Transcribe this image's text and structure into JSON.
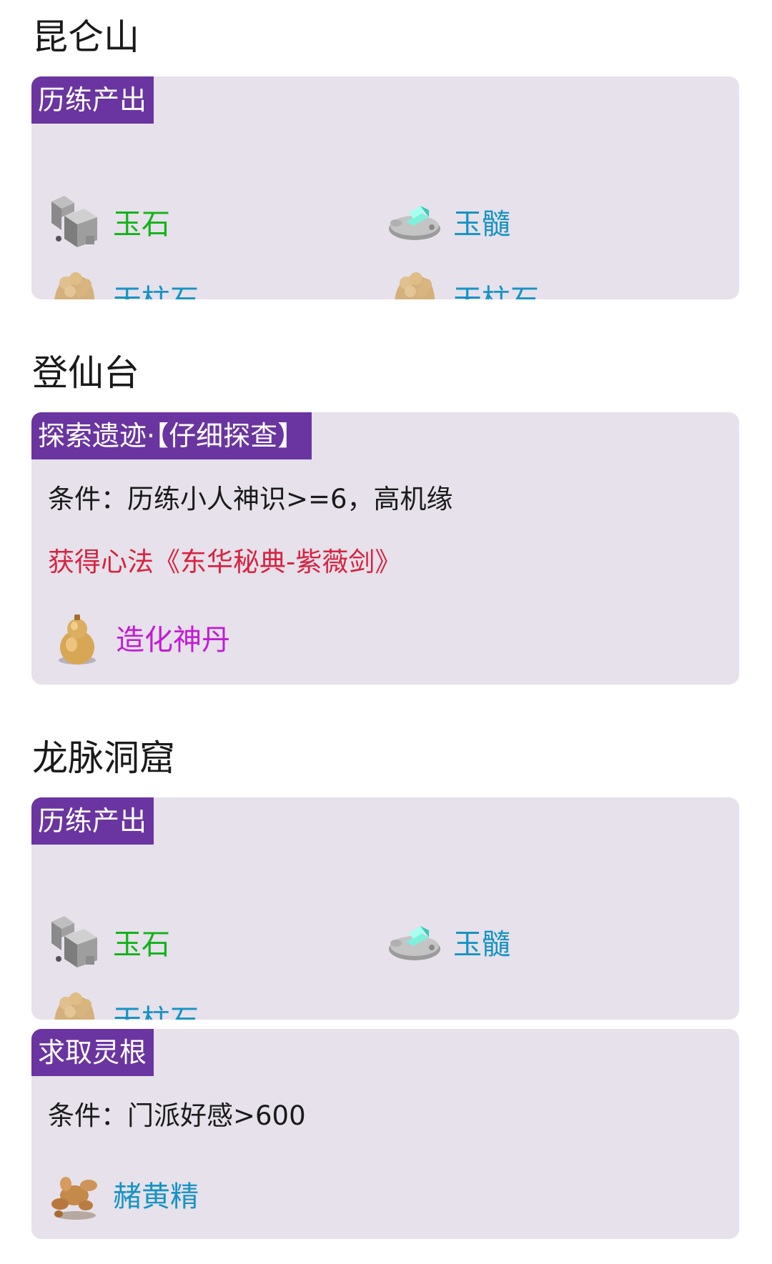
{
  "sections": [
    {
      "title": "昆仑山",
      "cards": [
        {
          "tag": "历练产出",
          "items": [
            {
              "label": "玉石",
              "icon": "jade-stone-icon",
              "color": "#13b21a"
            },
            {
              "label": "玉髓",
              "icon": "jade-marrow-icon",
              "color": "#1793c4"
            },
            {
              "label": "天柱石",
              "icon": "pillar-stone-icon",
              "color": "#1793c4"
            },
            {
              "label": "天柱石",
              "icon": "pillar-stone-icon",
              "color": "#1793c4"
            }
          ]
        }
      ]
    },
    {
      "title": "登仙台",
      "cards": [
        {
          "tag": "探索遗迹·【仔细探查】",
          "condition": "条件：历练小人神识>=6，高机缘",
          "reward_text": "获得心法《东华秘典-紫薇剑》",
          "items": [
            {
              "label": "造化神丹",
              "icon": "gourd-icon",
              "color": "#c21cd6"
            }
          ]
        }
      ]
    },
    {
      "title": "龙脉洞窟",
      "cards": [
        {
          "tag": "历练产出",
          "items": [
            {
              "label": "玉石",
              "icon": "jade-stone-icon",
              "color": "#13b21a"
            },
            {
              "label": "玉髓",
              "icon": "jade-marrow-icon",
              "color": "#1793c4"
            },
            {
              "label": "天柱石",
              "icon": "pillar-stone-icon",
              "color": "#1793c4"
            }
          ]
        },
        {
          "tag": "求取灵根",
          "condition": "条件：门派好感>600",
          "items": [
            {
              "label": "赭黄精",
              "icon": "ginseng-root-icon",
              "color": "#1793c4"
            }
          ]
        }
      ]
    }
  ],
  "colors": {
    "tag_bg": "#6a35a0",
    "card_bg": "#e6e1ea",
    "reward_red": "#d62442"
  }
}
